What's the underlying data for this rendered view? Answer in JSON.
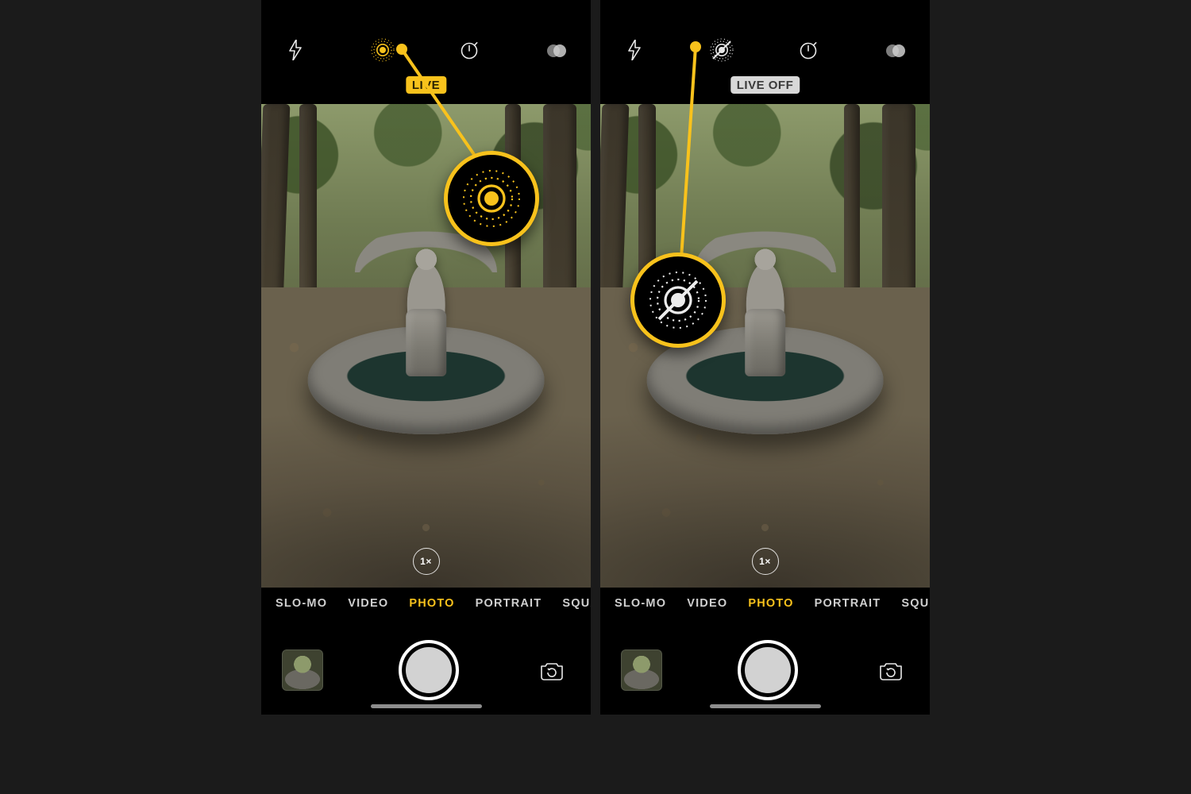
{
  "colors": {
    "accent_yellow": "#f8c21c"
  },
  "zoom_label": "1×",
  "modes": {
    "slo_mo": "SLO-MO",
    "video": "VIDEO",
    "photo": "PHOTO",
    "portrait": "PORTRAIT",
    "square_truncated": "SQUAR"
  },
  "left": {
    "live_state": "on",
    "badge": "LIVE"
  },
  "right": {
    "live_state": "off",
    "badge": "LIVE OFF"
  }
}
